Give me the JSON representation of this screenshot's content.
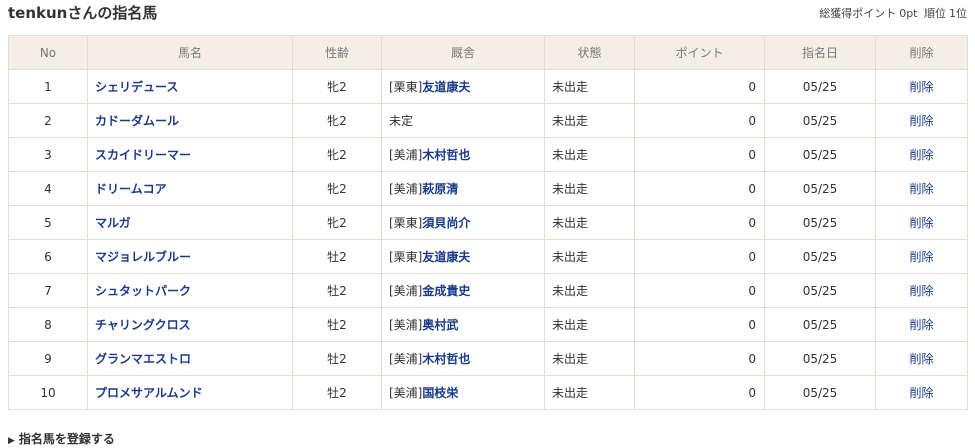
{
  "page": {
    "title": "tenkunさんの指名馬",
    "total_points_label": "総獲得ポイント",
    "total_points_value": "0pt",
    "rank_label": "順位",
    "rank_value": "1位"
  },
  "table": {
    "headers": [
      "No",
      "馬名",
      "性齢",
      "厩舎",
      "状態",
      "ポイント",
      "指名日",
      "削除"
    ],
    "rows": [
      {
        "no": "1",
        "name": "シェリデュース",
        "sex_age": "牝2",
        "stable_region": "[栗東]",
        "trainer": "友道康夫",
        "status": "未出走",
        "points": "0",
        "date": "05/25",
        "delete": "削除"
      },
      {
        "no": "2",
        "name": "カドーダムール",
        "sex_age": "牝2",
        "stable_region": "",
        "trainer": "未定",
        "status": "未出走",
        "points": "0",
        "date": "05/25",
        "delete": "削除"
      },
      {
        "no": "3",
        "name": "スカイドリーマー",
        "sex_age": "牝2",
        "stable_region": "[美浦]",
        "trainer": "木村哲也",
        "status": "未出走",
        "points": "0",
        "date": "05/25",
        "delete": "削除"
      },
      {
        "no": "4",
        "name": "ドリームコア",
        "sex_age": "牝2",
        "stable_region": "[美浦]",
        "trainer": "萩原清",
        "status": "未出走",
        "points": "0",
        "date": "05/25",
        "delete": "削除"
      },
      {
        "no": "5",
        "name": "マルガ",
        "sex_age": "牝2",
        "stable_region": "[栗東]",
        "trainer": "須貝尚介",
        "status": "未出走",
        "points": "0",
        "date": "05/25",
        "delete": "削除"
      },
      {
        "no": "6",
        "name": "マジョレルブルー",
        "sex_age": "牡2",
        "stable_region": "[栗東]",
        "trainer": "友道康夫",
        "status": "未出走",
        "points": "0",
        "date": "05/25",
        "delete": "削除"
      },
      {
        "no": "7",
        "name": "シュタットパーク",
        "sex_age": "牡2",
        "stable_region": "[美浦]",
        "trainer": "金成貴史",
        "status": "未出走",
        "points": "0",
        "date": "05/25",
        "delete": "削除"
      },
      {
        "no": "8",
        "name": "チャリングクロス",
        "sex_age": "牡2",
        "stable_region": "[美浦]",
        "trainer": "奥村武",
        "status": "未出走",
        "points": "0",
        "date": "05/25",
        "delete": "削除"
      },
      {
        "no": "9",
        "name": "グランマエストロ",
        "sex_age": "牡2",
        "stable_region": "[美浦]",
        "trainer": "木村哲也",
        "status": "未出走",
        "points": "0",
        "date": "05/25",
        "delete": "削除"
      },
      {
        "no": "10",
        "name": "プロメサアルムンド",
        "sex_age": "牡2",
        "stable_region": "[美浦]",
        "trainer": "国枝栄",
        "status": "未出走",
        "points": "0",
        "date": "05/25",
        "delete": "削除"
      }
    ]
  },
  "footer": {
    "register_label": "指名馬を登録する",
    "register_icon": "triangle-right-icon"
  },
  "colors": {
    "link": "#1a3a8a",
    "header_bg": "#f3efe6",
    "border": "#e3ddd3"
  }
}
